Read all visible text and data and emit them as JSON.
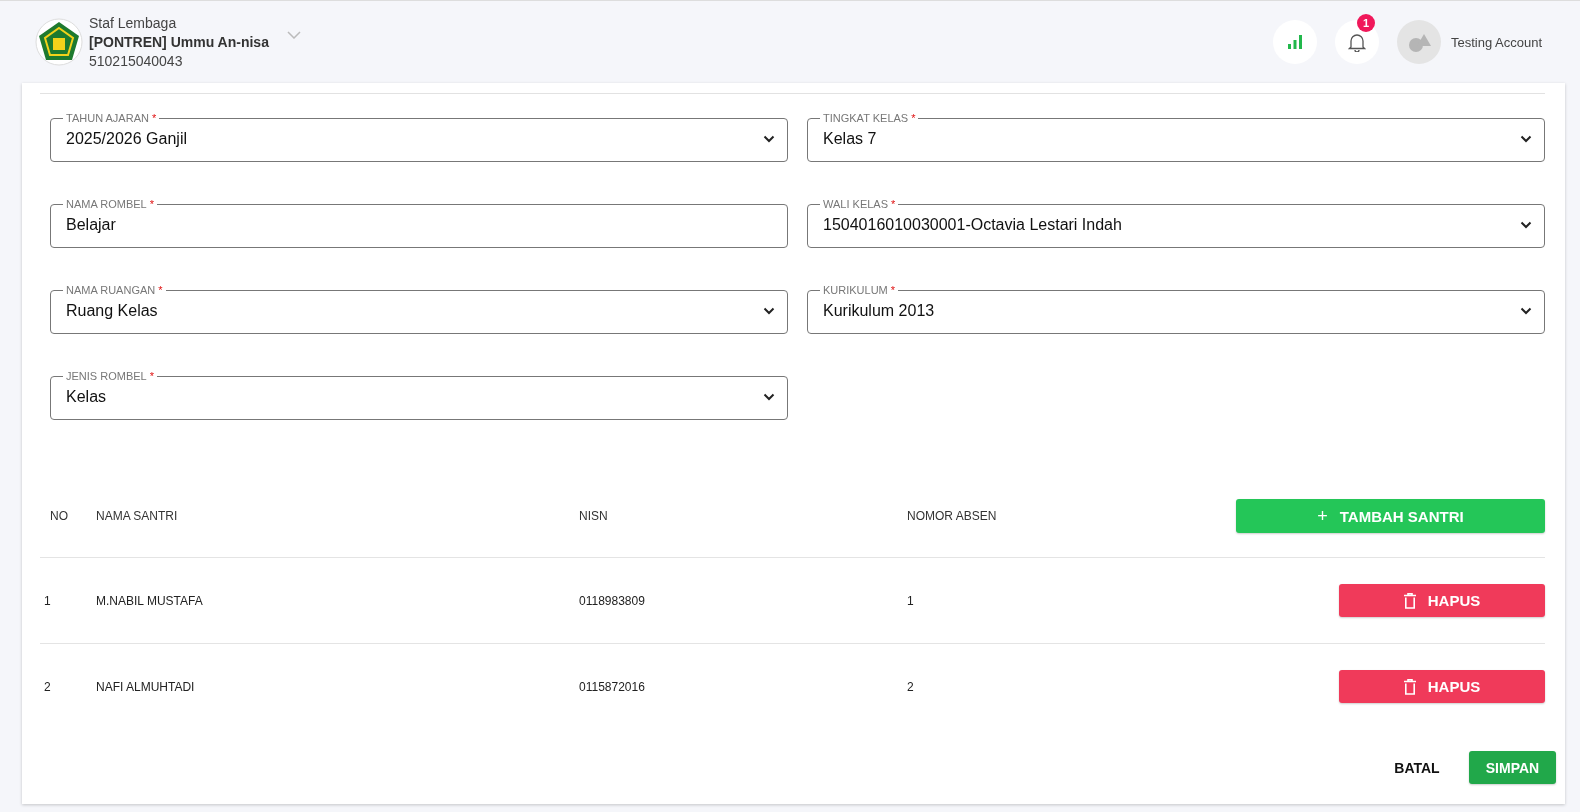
{
  "header": {
    "role": "Staf Lembaga",
    "institution": "[PONTREN] Ummu An-nisa",
    "code": "510215040043",
    "notification_count": "1",
    "account_name": "Testing Account"
  },
  "form_fields": [
    {
      "kind": "select",
      "label": "TAHUN AJARAN",
      "required_mark": "*",
      "value": "2025/2026 Ganjil"
    },
    {
      "kind": "select",
      "label": "TINGKAT KELAS",
      "required_mark": "*",
      "value": "Kelas 7"
    },
    {
      "kind": "text",
      "label": "NAMA ROMBEL",
      "required_mark": "*",
      "value": "Belajar"
    },
    {
      "kind": "select",
      "label": "WALI KELAS",
      "required_mark": "*",
      "value": "1504016010030001-Octavia Lestari Indah"
    },
    {
      "kind": "select",
      "label": "NAMA RUANGAN",
      "required_mark": "*",
      "value": "Ruang Kelas"
    },
    {
      "kind": "select",
      "label": "KURIKULUM",
      "required_mark": "*",
      "value": "Kurikulum 2013"
    },
    {
      "kind": "select",
      "label": "JENIS ROMBEL",
      "required_mark": "*",
      "value": "Kelas"
    }
  ],
  "table": {
    "columns": [
      "NO",
      "NAMA SANTRI",
      "NISN",
      "NOMOR ABSEN"
    ],
    "add_button": {
      "icon": "+",
      "label": "TAMBAH SANTRI"
    },
    "rows": [
      {
        "no": "1",
        "name": "M.NABIL MUSTAFA",
        "nisn": "0118983809",
        "absen": "1",
        "delete_label": "HAPUS"
      },
      {
        "no": "2",
        "name": "NAFI ALMUHTADI",
        "nisn": "0115872016",
        "absen": "2",
        "delete_label": "HAPUS"
      }
    ]
  },
  "footer_buttons": [
    {
      "kind": "text",
      "label": "BATAL"
    },
    {
      "kind": "primary",
      "label": "SIMPAN"
    }
  ]
}
